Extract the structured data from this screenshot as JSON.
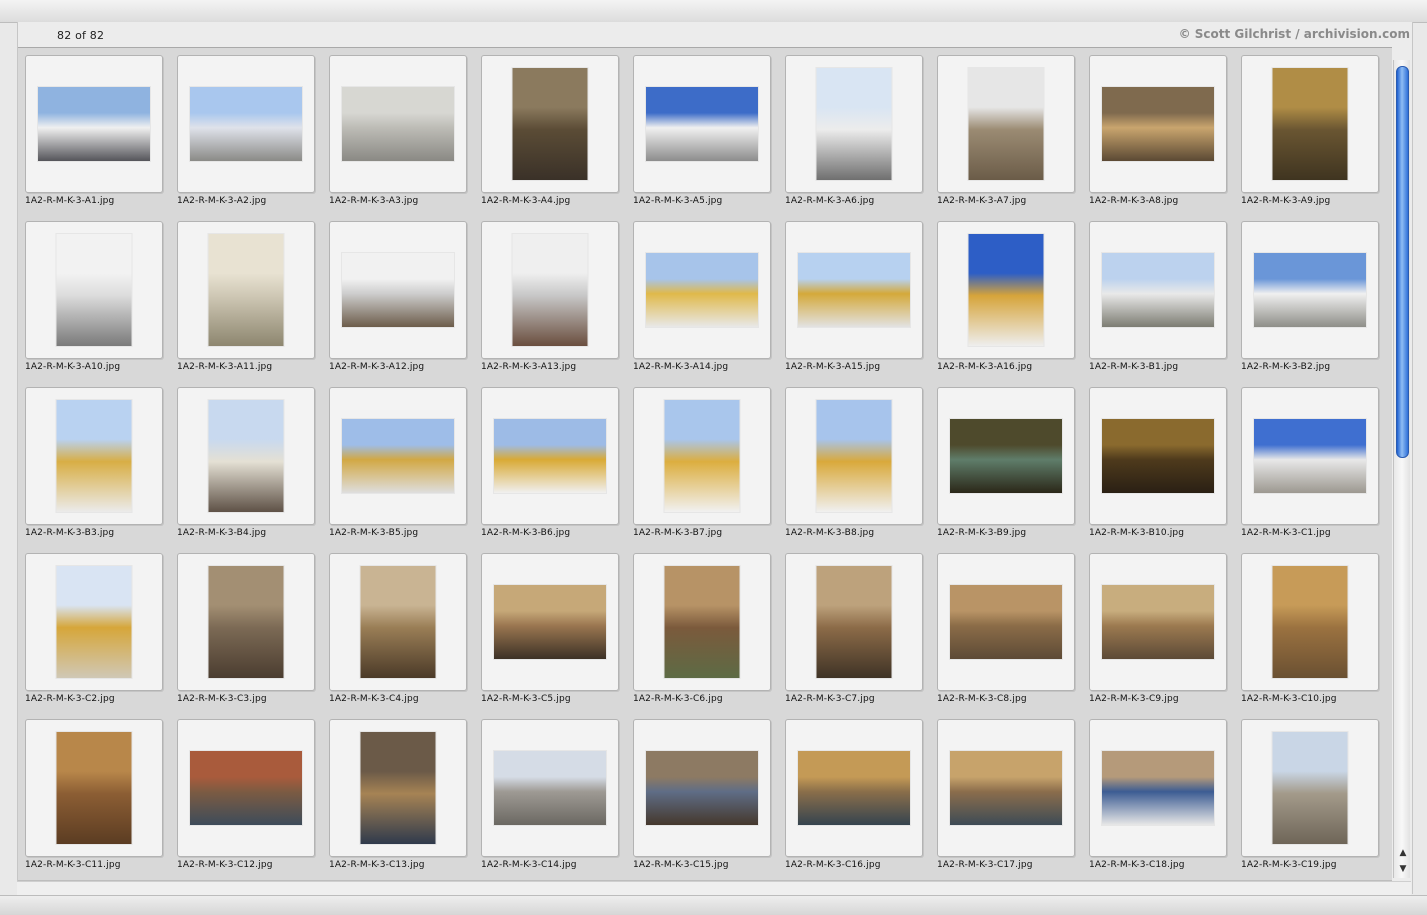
{
  "header": {
    "count": "82 of 82",
    "credit": "© Scott Gilchrist / archivision.com"
  },
  "thumbnails": [
    {
      "file": "1A2-R-M-K-3-A1.jpg",
      "orient": "land",
      "colors": [
        "#8fb3e0",
        "#f0f0f0",
        "#55555a"
      ]
    },
    {
      "file": "1A2-R-M-K-3-A2.jpg",
      "orient": "land",
      "colors": [
        "#a9c7ee",
        "#dfe2ea",
        "#8a8a86"
      ]
    },
    {
      "file": "1A2-R-M-K-3-A3.jpg",
      "orient": "land",
      "colors": [
        "#d7d7d2",
        "#bdbcb6",
        "#8a8984"
      ]
    },
    {
      "file": "1A2-R-M-K-3-A4.jpg",
      "orient": "port",
      "colors": [
        "#8b7a5e",
        "#5b4c36",
        "#3a3128"
      ]
    },
    {
      "file": "1A2-R-M-K-3-A5.jpg",
      "orient": "land",
      "colors": [
        "#3d6cc8",
        "#f0f0f0",
        "#8c8c8c"
      ]
    },
    {
      "file": "1A2-R-M-K-3-A6.jpg",
      "orient": "port",
      "colors": [
        "#d9e5f3",
        "#ececec",
        "#6f6f6f"
      ]
    },
    {
      "file": "1A2-R-M-K-3-A7.jpg",
      "orient": "port",
      "colors": [
        "#e6e6e6",
        "#9b8b73",
        "#6b5c48"
      ]
    },
    {
      "file": "1A2-R-M-K-3-A8.jpg",
      "orient": "land",
      "colors": [
        "#7f6a4e",
        "#c9a56e",
        "#5b4934"
      ]
    },
    {
      "file": "1A2-R-M-K-3-A9.jpg",
      "orient": "port",
      "colors": [
        "#b08d46",
        "#6a5632",
        "#3f3420"
      ]
    },
    {
      "file": "1A2-R-M-K-3-A10.jpg",
      "orient": "port",
      "colors": [
        "#f2f2f2",
        "#dcdcdc",
        "#7a7a7a"
      ]
    },
    {
      "file": "1A2-R-M-K-3-A11.jpg",
      "orient": "port",
      "colors": [
        "#e8e2d2",
        "#cfc8b5",
        "#8d866f"
      ]
    },
    {
      "file": "1A2-R-M-K-3-A12.jpg",
      "orient": "land",
      "colors": [
        "#f1f1f1",
        "#cdcdcd",
        "#6c5c4a"
      ]
    },
    {
      "file": "1A2-R-M-K-3-A13.jpg",
      "orient": "port",
      "colors": [
        "#efefef",
        "#c7c7c7",
        "#6a4e3e"
      ]
    },
    {
      "file": "1A2-R-M-K-3-A14.jpg",
      "orient": "land",
      "colors": [
        "#a7c4ea",
        "#e0b94a",
        "#e8e8e8"
      ]
    },
    {
      "file": "1A2-R-M-K-3-A15.jpg",
      "orient": "land",
      "colors": [
        "#b7d1f0",
        "#d4a93a",
        "#e2e2e2"
      ]
    },
    {
      "file": "1A2-R-M-K-3-A16.jpg",
      "orient": "port",
      "colors": [
        "#2d5ec6",
        "#d6a43a",
        "#eeeeee"
      ]
    },
    {
      "file": "1A2-R-M-K-3-B1.jpg",
      "orient": "land",
      "colors": [
        "#bcd2ee",
        "#e9e9e9",
        "#7c7c72"
      ]
    },
    {
      "file": "1A2-R-M-K-3-B2.jpg",
      "orient": "land",
      "colors": [
        "#6a96d8",
        "#f0f0f0",
        "#8e8e88"
      ]
    },
    {
      "file": "1A2-R-M-K-3-B3.jpg",
      "orient": "port",
      "colors": [
        "#b9d2f1",
        "#d8ae45",
        "#ebebeb"
      ]
    },
    {
      "file": "1A2-R-M-K-3-B4.jpg",
      "orient": "port",
      "colors": [
        "#c8d9ef",
        "#e4e0d4",
        "#5e5146"
      ]
    },
    {
      "file": "1A2-R-M-K-3-B5.jpg",
      "orient": "land",
      "colors": [
        "#9ebde8",
        "#d2a844",
        "#dedede"
      ]
    },
    {
      "file": "1A2-R-M-K-3-B6.jpg",
      "orient": "land",
      "colors": [
        "#9dbbe6",
        "#d9aa35",
        "#f0f0f0"
      ]
    },
    {
      "file": "1A2-R-M-K-3-B7.jpg",
      "orient": "port",
      "colors": [
        "#a9c6ec",
        "#dcae3f",
        "#f1f1f1"
      ]
    },
    {
      "file": "1A2-R-M-K-3-B8.jpg",
      "orient": "port",
      "colors": [
        "#a7c4ec",
        "#d9a93b",
        "#f0f0f0"
      ]
    },
    {
      "file": "1A2-R-M-K-3-B9.jpg",
      "orient": "land",
      "colors": [
        "#4e4a2c",
        "#5f7d6a",
        "#2b2718"
      ]
    },
    {
      "file": "1A2-R-M-K-3-B10.jpg",
      "orient": "land",
      "colors": [
        "#8a6a2e",
        "#4e3a1c",
        "#2a2014"
      ]
    },
    {
      "file": "1A2-R-M-K-3-C1.jpg",
      "orient": "land",
      "colors": [
        "#3f6fd0",
        "#e8e8e8",
        "#9c9890"
      ]
    },
    {
      "file": "1A2-R-M-K-3-C2.jpg",
      "orient": "port",
      "colors": [
        "#d9e4f3",
        "#d6a63a",
        "#d0c8b6"
      ]
    },
    {
      "file": "1A2-R-M-K-3-C3.jpg",
      "orient": "port",
      "colors": [
        "#a38f73",
        "#7c6a55",
        "#4b3d30"
      ]
    },
    {
      "file": "1A2-R-M-K-3-C4.jpg",
      "orient": "port",
      "colors": [
        "#c9b493",
        "#9a7e56",
        "#4b3a28"
      ]
    },
    {
      "file": "1A2-R-M-K-3-C5.jpg",
      "orient": "land",
      "colors": [
        "#c6a878",
        "#9a7650",
        "#3c3126"
      ]
    },
    {
      "file": "1A2-R-M-K-3-C6.jpg",
      "orient": "port",
      "colors": [
        "#b79366",
        "#7b5a3c",
        "#5d6b45"
      ]
    },
    {
      "file": "1A2-R-M-K-3-C7.jpg",
      "orient": "port",
      "colors": [
        "#bda27c",
        "#8c6b48",
        "#3f3326"
      ]
    },
    {
      "file": "1A2-R-M-K-3-C8.jpg",
      "orient": "land",
      "colors": [
        "#b99466",
        "#8b6c48",
        "#5d4a36"
      ]
    },
    {
      "file": "1A2-R-M-K-3-C9.jpg",
      "orient": "land",
      "colors": [
        "#c8ad7e",
        "#9c7a50",
        "#5c4a37"
      ]
    },
    {
      "file": "1A2-R-M-K-3-C10.jpg",
      "orient": "port",
      "colors": [
        "#c79b58",
        "#9b7240",
        "#6a5032"
      ]
    },
    {
      "file": "1A2-R-M-K-3-C11.jpg",
      "orient": "port",
      "colors": [
        "#b8874a",
        "#8c5e34",
        "#5b3c22"
      ]
    },
    {
      "file": "1A2-R-M-K-3-C12.jpg",
      "orient": "land",
      "colors": [
        "#a95b3c",
        "#7c5b42",
        "#3d4c5a"
      ]
    },
    {
      "file": "1A2-R-M-K-3-C13.jpg",
      "orient": "port",
      "colors": [
        "#6b5a48",
        "#a68354",
        "#2f3a4c"
      ]
    },
    {
      "file": "1A2-R-M-K-3-C14.jpg",
      "orient": "land",
      "colors": [
        "#d5dce6",
        "#9e9a94",
        "#6b6862"
      ]
    },
    {
      "file": "1A2-R-M-K-3-C15.jpg",
      "orient": "land",
      "colors": [
        "#8d7a63",
        "#5f6d86",
        "#45382c"
      ]
    },
    {
      "file": "1A2-R-M-K-3-C16.jpg",
      "orient": "land",
      "colors": [
        "#c49a56",
        "#8a6e4a",
        "#35444f"
      ]
    },
    {
      "file": "1A2-R-M-K-3-C17.jpg",
      "orient": "land",
      "colors": [
        "#c7a36b",
        "#8b6d4c",
        "#3d4b55"
      ]
    },
    {
      "file": "1A2-R-M-K-3-C18.jpg",
      "orient": "land",
      "colors": [
        "#b59a7a",
        "#3c5c93",
        "#e7e7e7"
      ]
    },
    {
      "file": "1A2-R-M-K-3-C19.jpg",
      "orient": "port",
      "colors": [
        "#c9d6e6",
        "#a39a8a",
        "#6e6558"
      ]
    }
  ],
  "scrollbar": {
    "up_arrow": "▲",
    "down_arrow": "▼"
  }
}
